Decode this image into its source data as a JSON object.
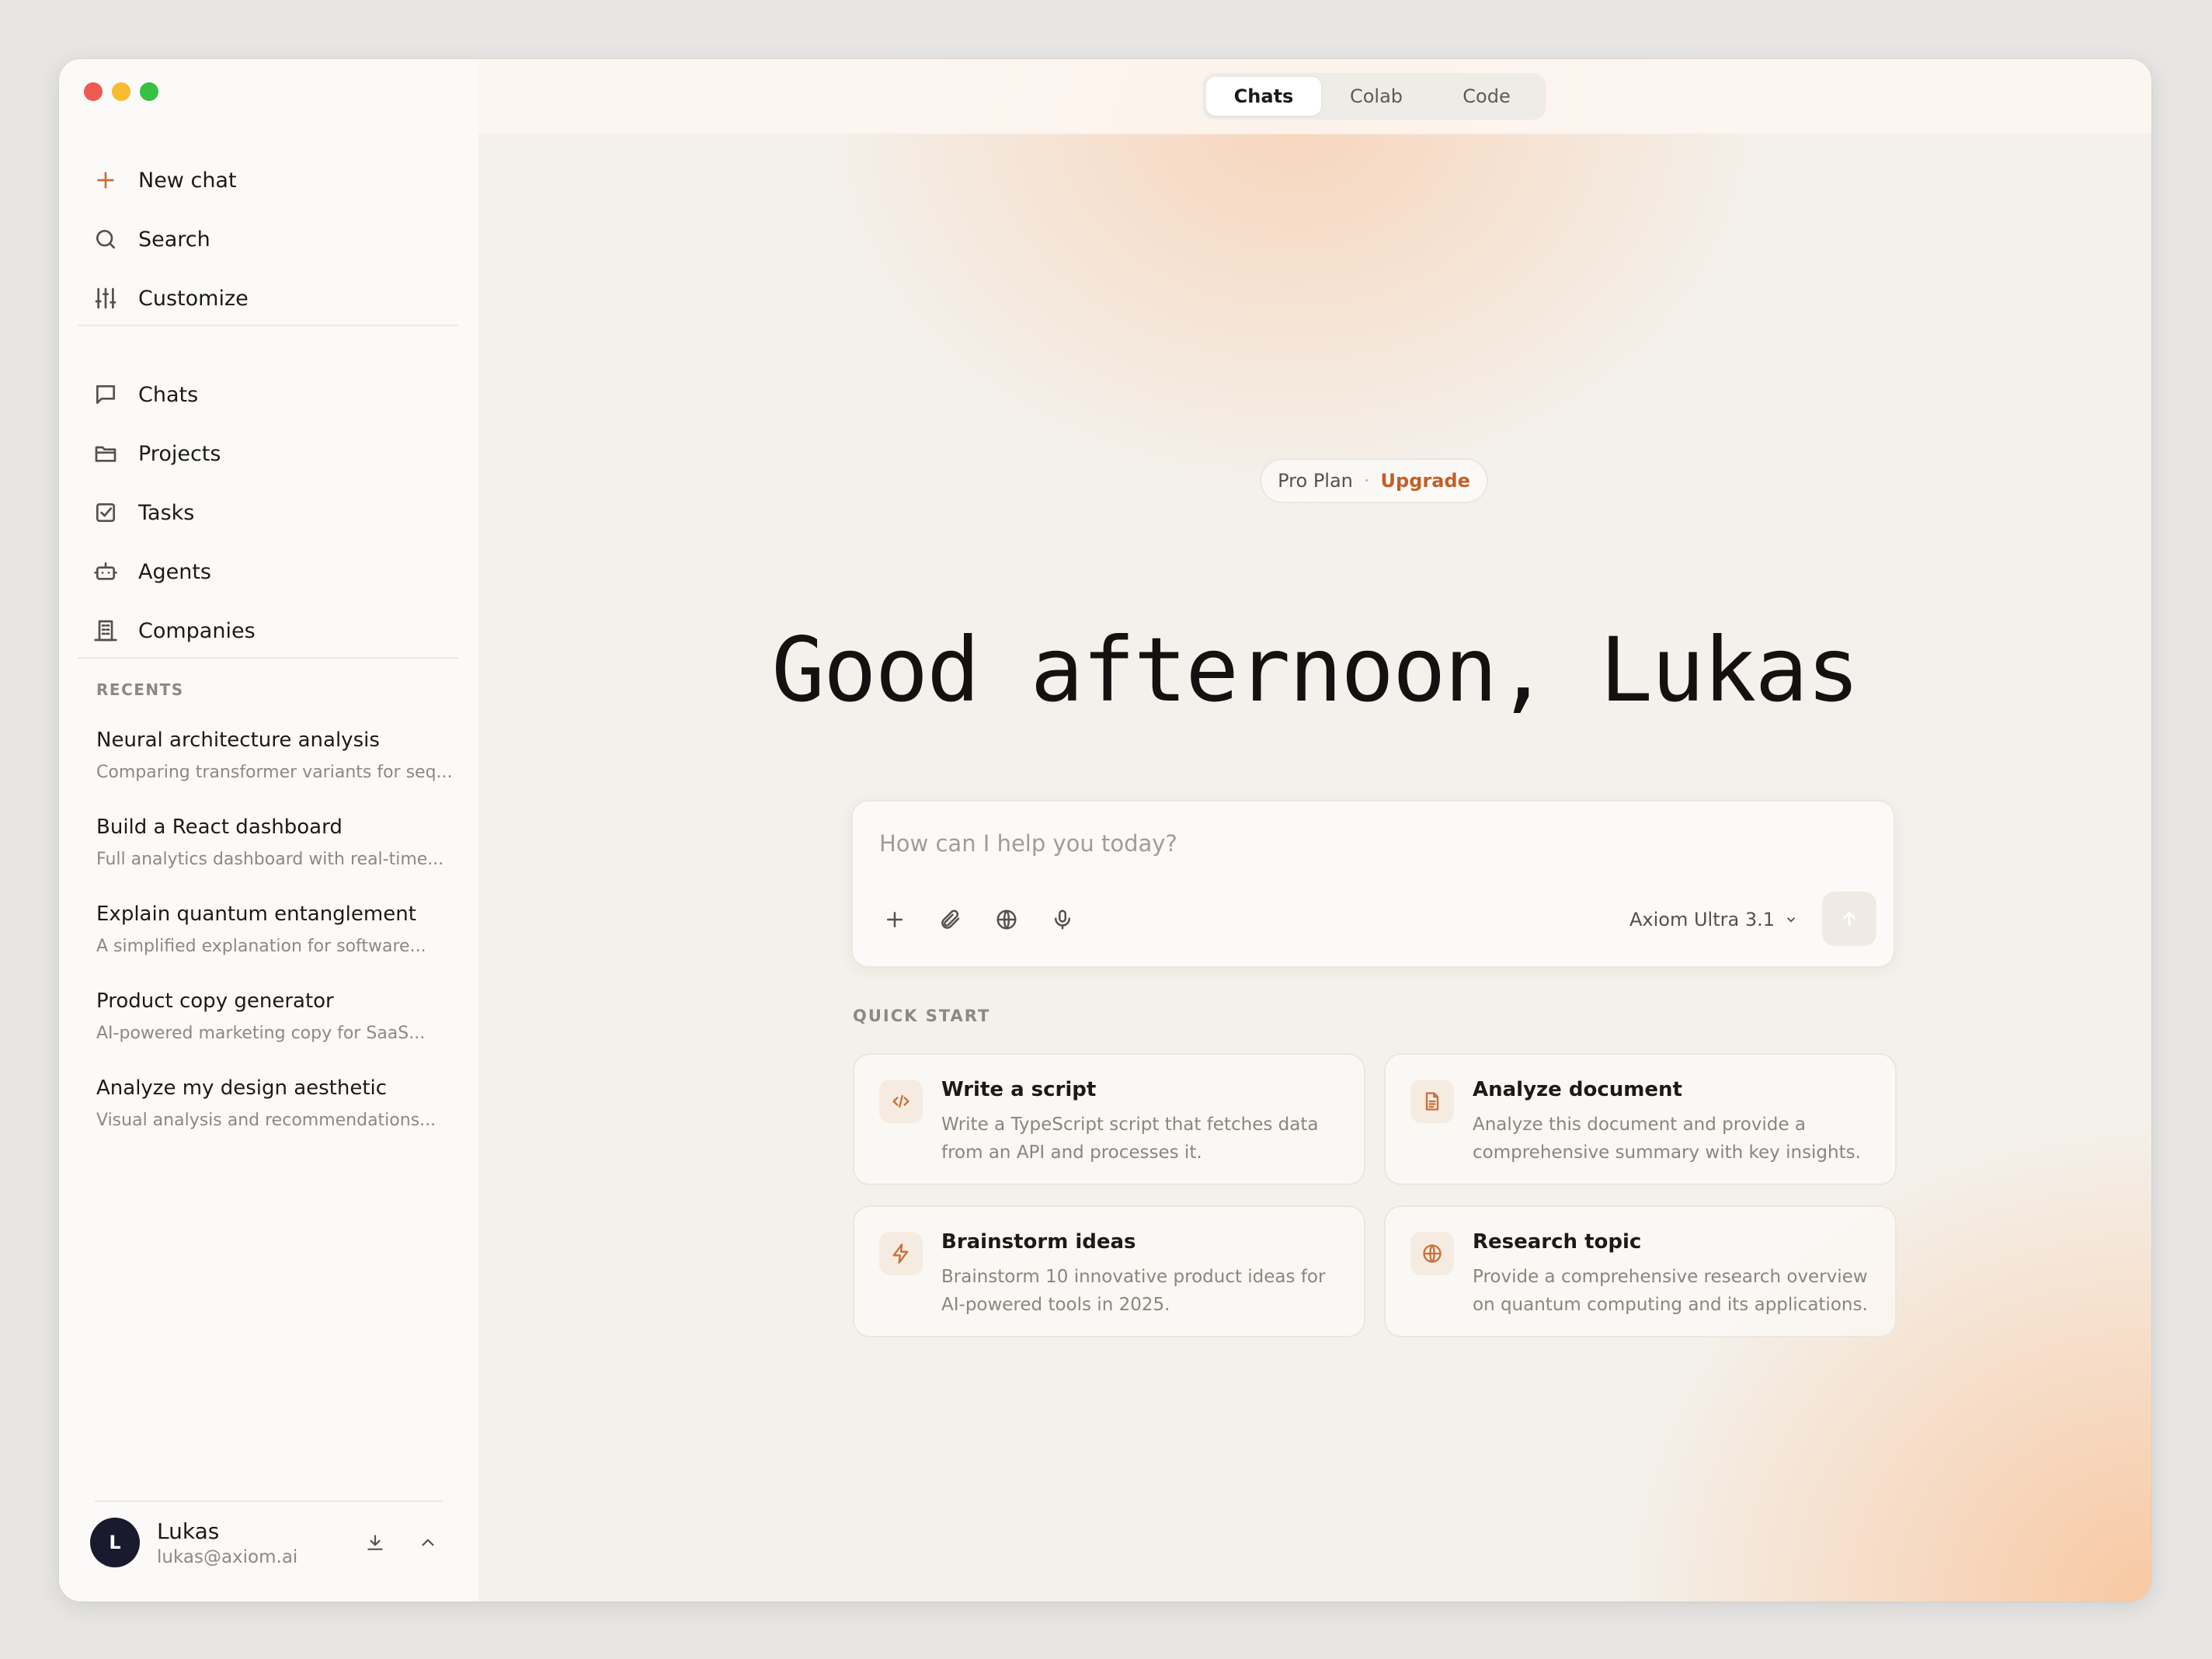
{
  "window": {
    "traffic_colors": [
      "#ee5b52",
      "#f6bb2f",
      "#36c143"
    ]
  },
  "sidebar": {
    "actions": [
      {
        "label": "New chat",
        "icon": "plus-icon"
      },
      {
        "label": "Search",
        "icon": "search-icon"
      },
      {
        "label": "Customize",
        "icon": "sliders-icon"
      }
    ],
    "nav": [
      {
        "label": "Chats",
        "icon": "chat-bubble-icon"
      },
      {
        "label": "Projects",
        "icon": "folder-icon"
      },
      {
        "label": "Tasks",
        "icon": "checkbox-icon"
      },
      {
        "label": "Agents",
        "icon": "robot-icon"
      },
      {
        "label": "Companies",
        "icon": "building-icon"
      }
    ],
    "recents_label": "RECENTS",
    "recents": [
      {
        "title": "Neural architecture analysis",
        "subtitle": "Comparing transformer variants for seq..."
      },
      {
        "title": "Build a React dashboard",
        "subtitle": "Full analytics dashboard with real-time..."
      },
      {
        "title": "Explain quantum entanglement",
        "subtitle": "A simplified explanation for software..."
      },
      {
        "title": "Product copy generator",
        "subtitle": "AI-powered marketing copy for SaaS..."
      },
      {
        "title": "Analyze my design aesthetic",
        "subtitle": "Visual analysis and recommendations..."
      }
    ],
    "user": {
      "initial": "L",
      "name": "Lukas",
      "email": "lukas@axiom.ai"
    }
  },
  "topbar": {
    "tabs": [
      {
        "label": "Chats",
        "active": true
      },
      {
        "label": "Colab",
        "active": false
      },
      {
        "label": "Code",
        "active": false
      }
    ]
  },
  "main": {
    "plan": {
      "name": "Pro Plan",
      "separator": "·",
      "upgrade": "Upgrade"
    },
    "greeting": "Good afternoon, Lukas",
    "composer": {
      "placeholder": "How can I help you today?",
      "model": "Axiom Ultra 3.1"
    },
    "quick_start_label": "QUICK START",
    "cards": [
      {
        "title": "Write a script",
        "desc": "Write a TypeScript script that fetches data from an API and processes it.",
        "icon": "code-icon"
      },
      {
        "title": "Analyze document",
        "desc": "Analyze this document and provide a comprehensive summary with key insights.",
        "icon": "document-icon"
      },
      {
        "title": "Brainstorm ideas",
        "desc": "Brainstorm 10 innovative product ideas for AI-powered tools in 2025.",
        "icon": "lightning-icon"
      },
      {
        "title": "Research topic",
        "desc": "Provide a comprehensive research overview on quantum computing and its applications.",
        "icon": "globe-icon"
      }
    ]
  },
  "colors": {
    "accent": "#c25f28",
    "avatar_bg": "#1a1a2e"
  }
}
